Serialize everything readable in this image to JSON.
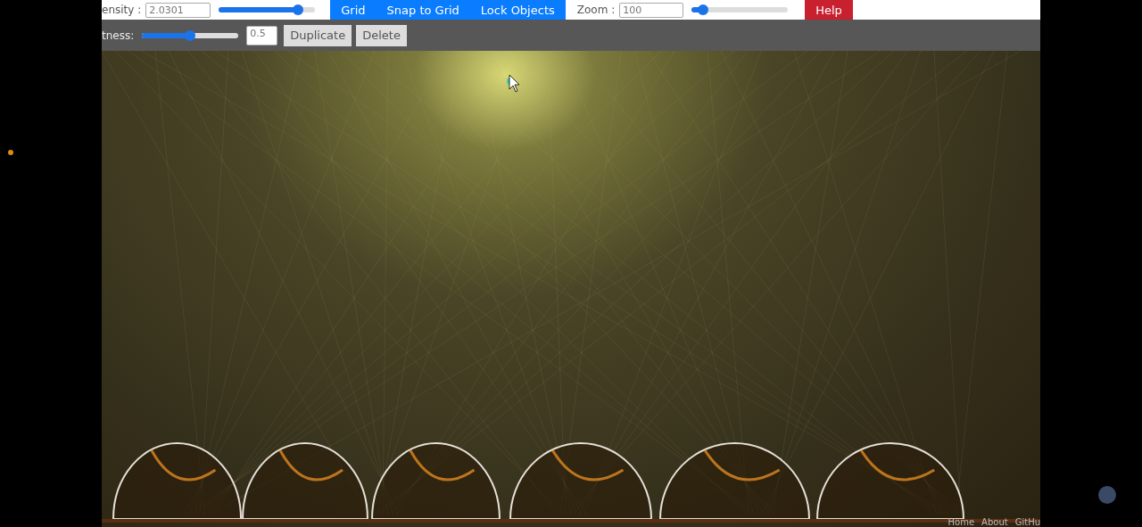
{
  "top_toolbar": {
    "density_label": "ensity :",
    "density_value": "2.0301",
    "density_slider": {
      "level": 0.82
    },
    "toggle_buttons": [
      "Grid",
      "Snap to Grid",
      "Lock Objects"
    ],
    "zoom_label": "Zoom :",
    "zoom_value": "100",
    "zoom_slider": {
      "level": 0.12
    },
    "help_button": "Help"
  },
  "object_toolbar": {
    "brightness_label": "tness:",
    "brightness_slider": {
      "level": 0.5
    },
    "brightness_value": "0.5",
    "buttons": [
      "Duplicate",
      "Delete"
    ]
  },
  "footer_links": [
    "Home",
    "About",
    "GitHu"
  ]
}
